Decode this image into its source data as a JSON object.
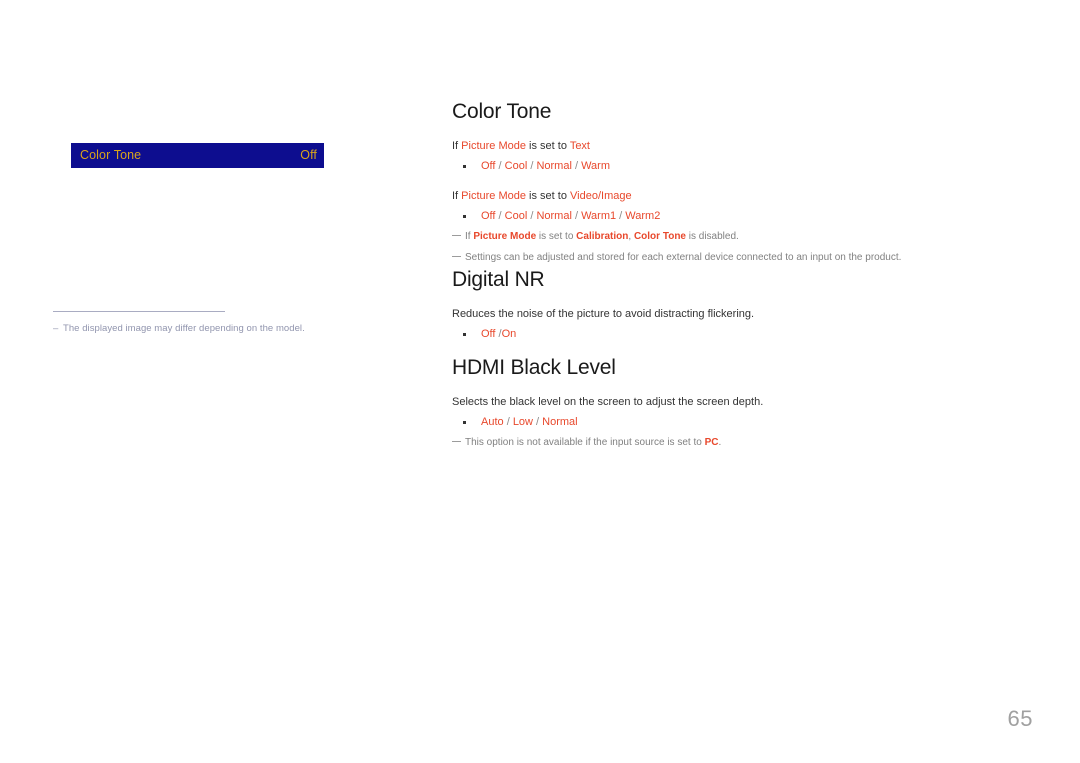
{
  "page": {
    "number": "65",
    "accent_red": "#e8482c",
    "osd_bg": "#0d0d8f",
    "osd_text": "#d9a41c",
    "note_gray": "#818181"
  },
  "osd_preview": {
    "label": "Color Tone",
    "value": "Off"
  },
  "left_footnote": {
    "dash": "–",
    "text": "The displayed image may differ depending on the model."
  },
  "sections": [
    {
      "id": "color-tone",
      "title": "Color Tone",
      "lines": [
        {
          "type": "lead",
          "parts": [
            {
              "t": "If ",
              "s": "plain"
            },
            {
              "t": "Picture Mode",
              "s": "red"
            },
            {
              "t": " is set to ",
              "s": "plain"
            },
            {
              "t": "Text",
              "s": "red"
            }
          ]
        },
        {
          "type": "options",
          "options": [
            "Off",
            "Cool",
            "Normal",
            "Warm"
          ],
          "separator": " / "
        },
        {
          "type": "lead",
          "parts": [
            {
              "t": "If ",
              "s": "plain"
            },
            {
              "t": "Picture Mode",
              "s": "red"
            },
            {
              "t": " is set to ",
              "s": "plain"
            },
            {
              "t": "Video/Image",
              "s": "red"
            }
          ]
        },
        {
          "type": "options",
          "options": [
            "Off",
            "Cool",
            "Normal",
            "Warm1",
            "Warm2"
          ],
          "separator": " / "
        },
        {
          "type": "note",
          "parts": [
            {
              "t": "If ",
              "s": "plain"
            },
            {
              "t": "Picture Mode",
              "s": "redbold"
            },
            {
              "t": " is set to ",
              "s": "plain"
            },
            {
              "t": "Calibration",
              "s": "redbold"
            },
            {
              "t": ", ",
              "s": "plain"
            },
            {
              "t": "Color Tone",
              "s": "redbold"
            },
            {
              "t": " is disabled.",
              "s": "plain"
            }
          ]
        },
        {
          "type": "note",
          "parts": [
            {
              "t": "Settings can be adjusted and stored for each external device connected to an input on the product.",
              "s": "plain"
            }
          ]
        }
      ]
    },
    {
      "id": "digital-nr",
      "title": "Digital NR",
      "lines": [
        {
          "type": "lead",
          "parts": [
            {
              "t": "Reduces the noise of the picture to avoid distracting flickering.",
              "s": "plain"
            }
          ]
        },
        {
          "type": "options",
          "options": [
            "Off",
            "On"
          ],
          "separator": " /"
        }
      ]
    },
    {
      "id": "hdmi-black-level",
      "title": "HDMI Black Level",
      "lines": [
        {
          "type": "lead",
          "parts": [
            {
              "t": "Selects the black level on the screen to adjust the screen depth.",
              "s": "plain"
            }
          ]
        },
        {
          "type": "options",
          "options": [
            "Auto",
            "Low",
            "Normal"
          ],
          "separator": " / "
        },
        {
          "type": "note",
          "parts": [
            {
              "t": "This option is not available if the input source is set to ",
              "s": "plain"
            },
            {
              "t": "PC",
              "s": "redbold"
            },
            {
              "t": ".",
              "s": "plain"
            }
          ]
        }
      ]
    }
  ]
}
